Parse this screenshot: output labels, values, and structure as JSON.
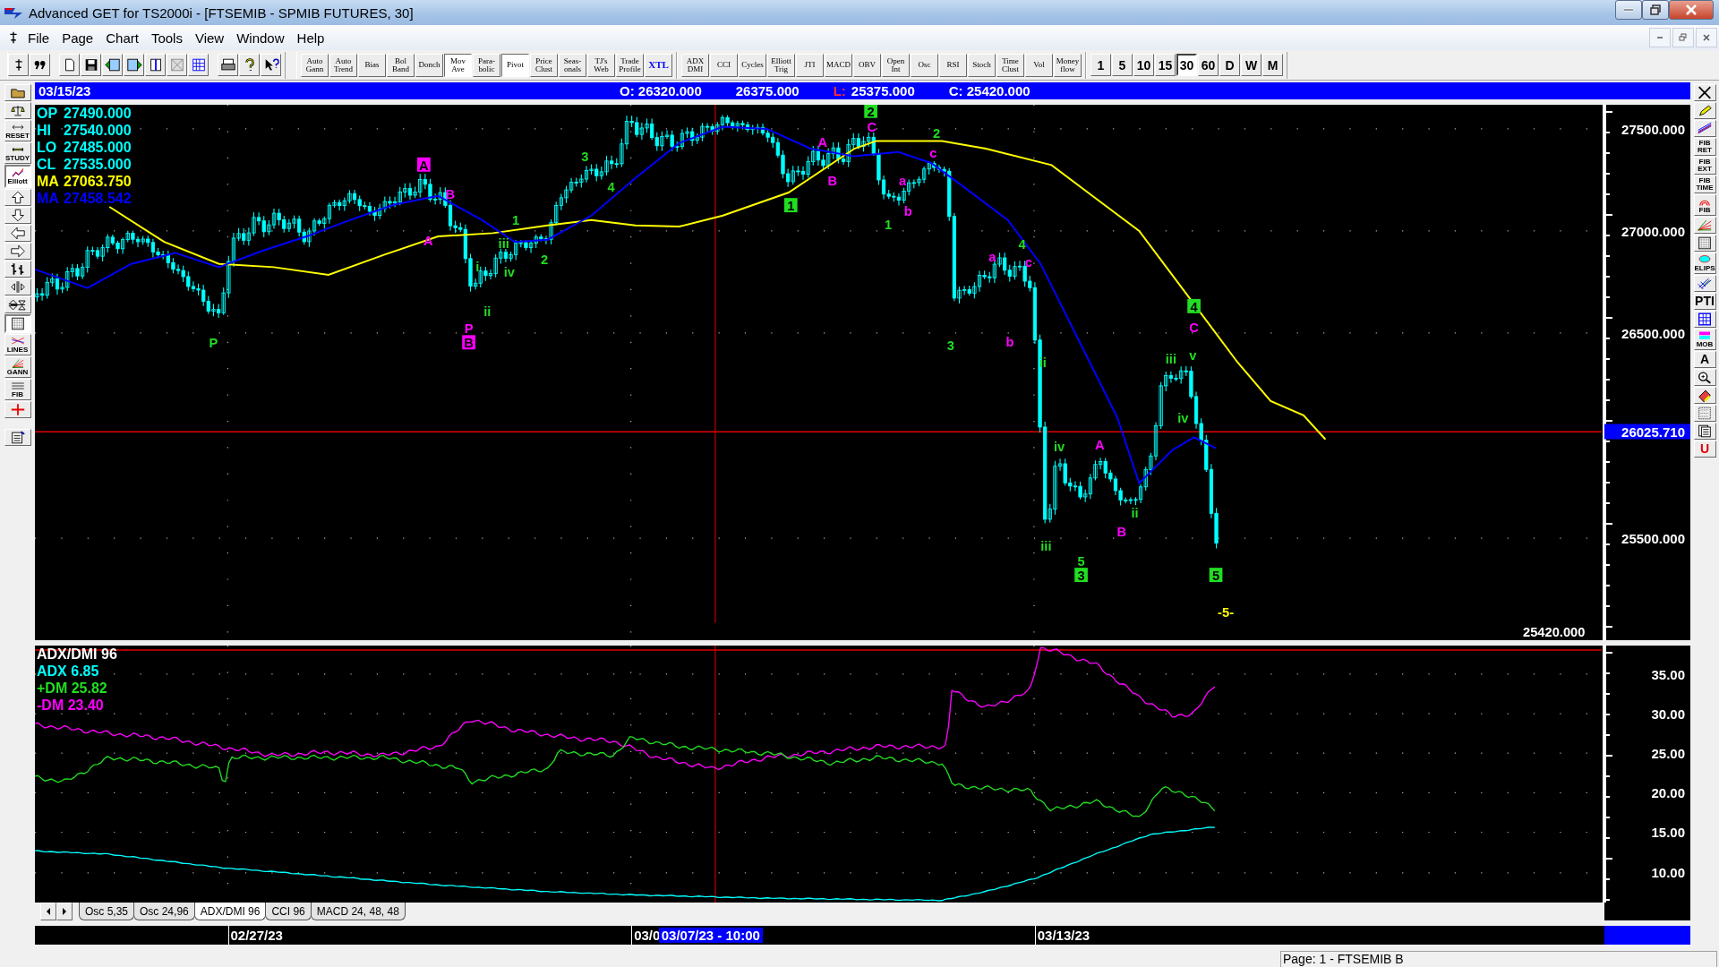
{
  "window": {
    "title": "Advanced GET for TS2000i - [FTSEMIB - SPMIB FUTURES, 30]"
  },
  "menu": [
    "File",
    "Page",
    "Chart",
    "Tools",
    "View",
    "Window",
    "Help"
  ],
  "toolbar": {
    "study_buttons": [
      {
        "label": "Auto Gann",
        "pressed": false
      },
      {
        "label": "Auto Trend",
        "pressed": false
      },
      {
        "label": "Bias",
        "pressed": false
      },
      {
        "label": "Bol Band",
        "pressed": false
      },
      {
        "label": "Donch",
        "pressed": false
      },
      {
        "label": "Mov Ave",
        "pressed": true
      },
      {
        "label": "Para- bolic",
        "pressed": false
      },
      {
        "label": "Pivot",
        "pressed": true
      },
      {
        "label": "Price Clust",
        "pressed": false
      },
      {
        "label": "Seas- onals",
        "pressed": false
      },
      {
        "label": "TJ's Web",
        "pressed": false
      },
      {
        "label": "Trade Profile",
        "pressed": false
      },
      {
        "label": "XTL",
        "pressed": false,
        "color": "#0000ff"
      }
    ],
    "indicator_buttons": [
      {
        "label": "ADX DMI",
        "pressed": false
      },
      {
        "label": "CCI",
        "pressed": false
      },
      {
        "label": "Cycles",
        "pressed": false
      },
      {
        "label": "Elliott Trig",
        "pressed": false
      },
      {
        "label": "JTI",
        "pressed": false
      },
      {
        "label": "MACD",
        "pressed": false
      },
      {
        "label": "OBV",
        "pressed": false
      },
      {
        "label": "Open Int",
        "pressed": false
      },
      {
        "label": "Osc",
        "pressed": false
      },
      {
        "label": "RSI",
        "pressed": false
      },
      {
        "label": "Stoch",
        "pressed": false
      },
      {
        "label": "Time Clust",
        "pressed": false
      },
      {
        "label": "Vol",
        "pressed": false
      },
      {
        "label": "Money flow",
        "pressed": false
      }
    ],
    "intervals": [
      {
        "label": "1",
        "selected": false
      },
      {
        "label": "5",
        "selected": false
      },
      {
        "label": "10",
        "selected": false
      },
      {
        "label": "15",
        "selected": false
      },
      {
        "label": "30",
        "selected": true
      },
      {
        "label": "60",
        "selected": false
      },
      {
        "label": "D",
        "selected": false
      },
      {
        "label": "W",
        "selected": false
      },
      {
        "label": "M",
        "selected": false
      }
    ]
  },
  "left_tools": [
    {
      "kind": "icon",
      "selected": false
    },
    {
      "kind": "icon",
      "selected": false
    },
    {
      "kind": "icon-caption",
      "caption": "RESET",
      "selected": false
    },
    {
      "kind": "icon-caption",
      "caption": "STUDY",
      "selected": false
    },
    {
      "kind": "icon-caption",
      "caption": "Elliott",
      "selected": true
    },
    {
      "kind": "icon",
      "selected": false
    },
    {
      "kind": "icon",
      "selected": false
    },
    {
      "kind": "icon",
      "selected": false
    },
    {
      "kind": "icon",
      "selected": false
    },
    {
      "kind": "icon",
      "selected": false
    },
    {
      "kind": "icon",
      "selected": false
    },
    {
      "kind": "icon",
      "selected": false
    },
    {
      "kind": "icon",
      "selected": true
    },
    {
      "kind": "icon-caption",
      "caption": "LINES",
      "selected": false
    },
    {
      "kind": "icon-caption",
      "caption": "GANN",
      "selected": false
    },
    {
      "kind": "icon-caption",
      "caption": "FIB",
      "selected": false
    },
    {
      "kind": "icon",
      "selected": false
    },
    {
      "kind": "icon",
      "selected": false
    }
  ],
  "right_tools": [
    {
      "kind": "icon"
    },
    {
      "kind": "icon"
    },
    {
      "kind": "icon"
    },
    {
      "kind": "caption",
      "caption": "FIB RET"
    },
    {
      "kind": "caption",
      "caption": "FIB EXT"
    },
    {
      "kind": "caption",
      "caption": "FIB TIME"
    },
    {
      "kind": "icon-caption",
      "caption": "FIB"
    },
    {
      "kind": "icon"
    },
    {
      "kind": "icon"
    },
    {
      "kind": "icon-caption",
      "caption": "ELIPS"
    },
    {
      "kind": "icon"
    },
    {
      "kind": "caption",
      "caption": "PTI"
    },
    {
      "kind": "icon"
    },
    {
      "kind": "icon-caption",
      "caption": "MOB"
    },
    {
      "kind": "caption",
      "caption": "A"
    },
    {
      "kind": "icon"
    },
    {
      "kind": "icon"
    },
    {
      "kind": "icon"
    },
    {
      "kind": "icon"
    },
    {
      "kind": "caption",
      "caption": "U",
      "color": "#e00000"
    }
  ],
  "chart_header": {
    "date": "03/15/23",
    "fields": [
      {
        "value": "O: 26320.000"
      },
      {
        "value": "26375.000"
      },
      {
        "label": "L:",
        "value": "25375.000"
      },
      {
        "value": "C: 25420.000"
      }
    ]
  },
  "price_chart": {
    "readouts": [
      {
        "label": "OP",
        "value": "27490.000",
        "color": "#00ffff"
      },
      {
        "label": "HI",
        "value": "27540.000",
        "color": "#00ffff"
      },
      {
        "label": "LO",
        "value": "27485.000",
        "color": "#00ffff"
      },
      {
        "label": "CL",
        "value": "27535.000",
        "color": "#00ffff"
      },
      {
        "label": "MA",
        "value": "27063.750",
        "color": "#ffff00"
      },
      {
        "label": "MA",
        "value": "27458.542",
        "color": "#0000ff"
      }
    ],
    "axis_labels": [
      "27500.000",
      "27000.000",
      "26500.000",
      "25500.000"
    ],
    "price_tag": "26025.710",
    "last_price": "25420.000",
    "wave_labels": [
      {
        "text": "P",
        "color": "#22dd22",
        "boxed": false
      },
      {
        "text": "A",
        "color": "#ff00ff",
        "boxed": true
      },
      {
        "text": "B",
        "color": "#ff00ff",
        "boxed": false
      },
      {
        "text": "A",
        "color": "#ff00ff",
        "boxed": false
      },
      {
        "text": "i",
        "color": "#22dd22",
        "boxed": false
      },
      {
        "text": "ii",
        "color": "#22dd22",
        "boxed": false
      },
      {
        "text": "P",
        "color": "#ff00ff",
        "boxed": false
      },
      {
        "text": "B",
        "color": "#ff00ff",
        "boxed": true
      },
      {
        "text": "1",
        "color": "#22dd22",
        "boxed": false
      },
      {
        "text": "iii",
        "color": "#22dd22",
        "boxed": false
      },
      {
        "text": "iv",
        "color": "#22dd22",
        "boxed": false
      },
      {
        "text": "2",
        "color": "#22dd22",
        "boxed": false
      },
      {
        "text": "3",
        "color": "#22dd22",
        "boxed": false
      },
      {
        "text": "4",
        "color": "#22dd22",
        "boxed": false
      },
      {
        "text": "A",
        "color": "#ff00ff",
        "boxed": false
      },
      {
        "text": "B",
        "color": "#ff00ff",
        "boxed": false
      },
      {
        "text": "2",
        "color": "#22dd22",
        "boxed": true
      },
      {
        "text": "C",
        "color": "#ff00ff",
        "boxed": false
      },
      {
        "text": "1",
        "color": "#22dd22",
        "boxed": true
      },
      {
        "text": "1",
        "color": "#22dd22",
        "boxed": false
      },
      {
        "text": "a",
        "color": "#ff00ff",
        "boxed": false
      },
      {
        "text": "b",
        "color": "#ff00ff",
        "boxed": false
      },
      {
        "text": "2",
        "color": "#22dd22",
        "boxed": false
      },
      {
        "text": "c",
        "color": "#ff00ff",
        "boxed": false
      },
      {
        "text": "a",
        "color": "#ff00ff",
        "boxed": false
      },
      {
        "text": "4",
        "color": "#22dd22",
        "boxed": false
      },
      {
        "text": "c",
        "color": "#ff00ff",
        "boxed": false
      },
      {
        "text": "3",
        "color": "#22dd22",
        "boxed": false
      },
      {
        "text": "b",
        "color": "#ff00ff",
        "boxed": false
      },
      {
        "text": "ii",
        "color": "#22dd22",
        "boxed": false
      },
      {
        "text": "iv",
        "color": "#22dd22",
        "boxed": false
      },
      {
        "text": "iii",
        "color": "#22dd22",
        "boxed": false
      },
      {
        "text": "5",
        "color": "#22dd22",
        "boxed": false
      },
      {
        "text": "3",
        "color": "#22dd22",
        "boxed": true
      },
      {
        "text": "A",
        "color": "#ff00ff",
        "boxed": false
      },
      {
        "text": "B",
        "color": "#ff00ff",
        "boxed": false
      },
      {
        "text": "ii",
        "color": "#22dd22",
        "boxed": false
      },
      {
        "text": "4",
        "color": "#22dd22",
        "boxed": true
      },
      {
        "text": "C",
        "color": "#ff00ff",
        "boxed": false
      },
      {
        "text": "iii",
        "color": "#22dd22",
        "boxed": false
      },
      {
        "text": "v",
        "color": "#22dd22",
        "boxed": false
      },
      {
        "text": "iv",
        "color": "#22dd22",
        "boxed": false
      },
      {
        "text": "5",
        "color": "#22dd22",
        "boxed": true
      },
      {
        "text": "-5-",
        "color": "#ffff00",
        "boxed": false
      }
    ]
  },
  "indicator": {
    "legend": [
      {
        "text": "ADX/DMI 96",
        "color": "#ffffff"
      },
      {
        "text": "ADX 6.85",
        "color": "#00ffff"
      },
      {
        "text": "+DM 25.82",
        "color": "#22dd22"
      },
      {
        "text": "-DM 23.40",
        "color": "#ff00ff"
      }
    ],
    "axis_labels": [
      "35.00",
      "30.00",
      "25.00",
      "20.00",
      "15.00",
      "10.00"
    ]
  },
  "indicator_tabs": [
    {
      "label": "Osc 5,35",
      "selected": false
    },
    {
      "label": "Osc 24,96",
      "selected": false
    },
    {
      "label": "ADX/DMI 96",
      "selected": true
    },
    {
      "label": "CCI 96",
      "selected": false
    },
    {
      "label": "MACD 24, 48, 48",
      "selected": false
    }
  ],
  "date_axis": {
    "labels": [
      "02/27/23",
      "03/0",
      "03/13/23"
    ],
    "cursor_label": "03/07/23 - 10:00"
  },
  "status_bar": "Page: 1 - FTSEMIB B"
}
